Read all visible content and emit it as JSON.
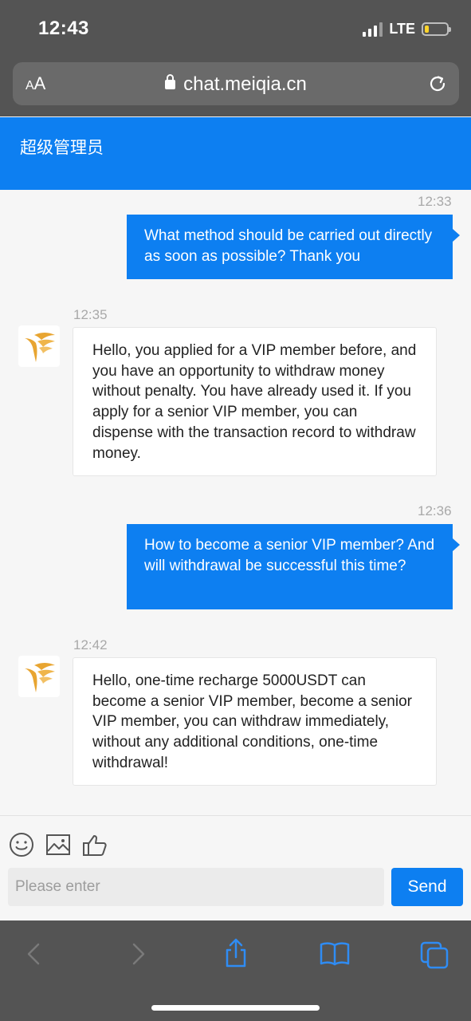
{
  "status_bar": {
    "time": "12:43",
    "network": "LTE",
    "signal_bars": 3,
    "battery_level": 0.15
  },
  "browser": {
    "text_size_label_small": "A",
    "text_size_label_large": "A",
    "url": "chat.meiqia.cn"
  },
  "chat": {
    "title": "超级管理员",
    "messages": [
      {
        "direction": "outgoing",
        "time": "12:33",
        "text": "What method should be carried out directly as soon as possible? Thank you"
      },
      {
        "direction": "incoming",
        "time": "12:35",
        "text": "Hello, you applied for a VIP member before, and you have an opportunity to withdraw money without penalty. You have already used it. If you apply for a senior VIP member, you can dispense with the transaction record to withdraw money."
      },
      {
        "direction": "outgoing",
        "time": "12:36",
        "text": "How to become a senior VIP member? And will withdrawal be successful this time?"
      },
      {
        "direction": "incoming",
        "time": "12:42",
        "text": "Hello, one-time recharge 5000USDT can become a senior VIP member, become a senior VIP member, you can withdraw immediately, without any additional conditions, one-time withdrawal!"
      }
    ]
  },
  "composer": {
    "placeholder": "Please enter",
    "send_label": "Send",
    "tools": [
      "emoji-icon",
      "image-icon",
      "thumbs-up-icon"
    ]
  },
  "colors": {
    "accent": "#0d7ff1",
    "chrome": "#545454",
    "battery": "#ffd42a",
    "logo_gold": "#e8a531"
  }
}
